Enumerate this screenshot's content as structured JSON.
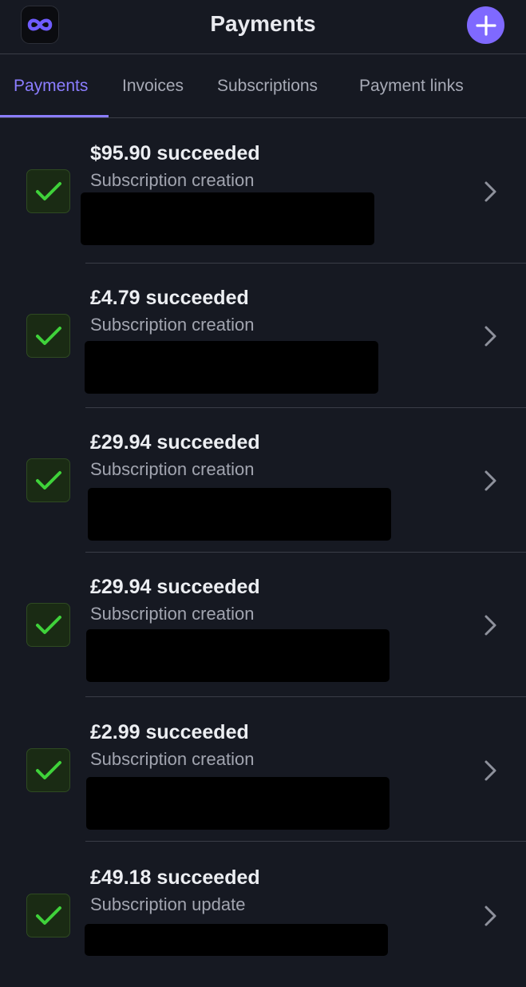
{
  "header": {
    "title": "Payments",
    "app_icon": "infinity-icon",
    "add_icon": "plus-icon",
    "accent": "#7f69ff"
  },
  "tabs": [
    {
      "label": "Payments",
      "active": true
    },
    {
      "label": "Invoices",
      "active": false
    },
    {
      "label": "Subscriptions",
      "active": false
    },
    {
      "label": "Payment links",
      "active": false
    }
  ],
  "payments": [
    {
      "amount": "$95.90 succeeded",
      "description": "Subscription creation",
      "status_icon": "checkmark-icon"
    },
    {
      "amount": "£4.79 succeeded",
      "description": "Subscription creation",
      "status_icon": "checkmark-icon"
    },
    {
      "amount": "£29.94 succeeded",
      "description": "Subscription creation",
      "status_icon": "checkmark-icon"
    },
    {
      "amount": "£29.94 succeeded",
      "description": "Subscription creation",
      "status_icon": "checkmark-icon"
    },
    {
      "amount": "£2.99 succeeded",
      "description": "Subscription creation",
      "status_icon": "checkmark-icon"
    },
    {
      "amount": "£49.18 succeeded",
      "description": "Subscription update",
      "status_icon": "checkmark-icon"
    }
  ],
  "colors": {
    "background": "#161922",
    "success_green": "#3fd23a",
    "active_tab": "#8b7dff"
  }
}
